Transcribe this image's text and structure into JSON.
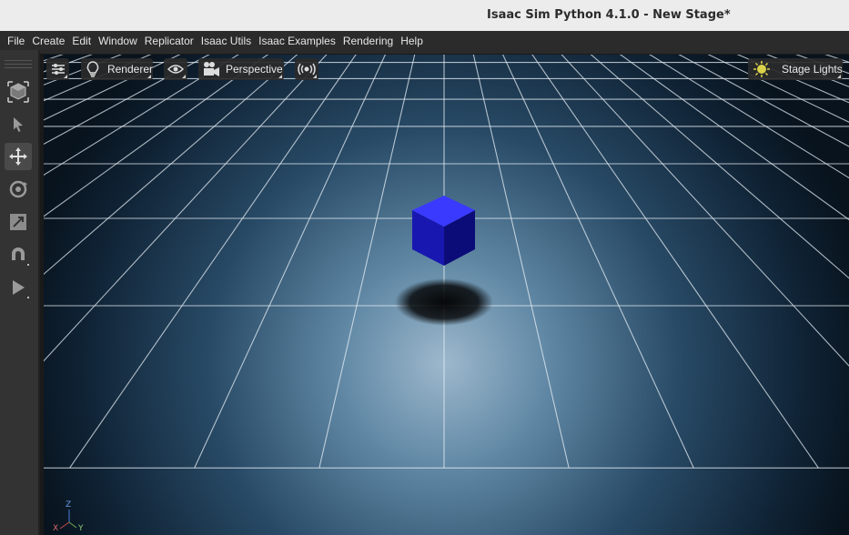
{
  "window": {
    "title": "Isaac Sim Python 4.1.0 - New Stage*"
  },
  "menubar": {
    "items": [
      "File",
      "Create",
      "Edit",
      "Window",
      "Replicator",
      "Isaac Utils",
      "Isaac Examples",
      "Rendering",
      "Help"
    ]
  },
  "left_toolbar": {
    "tools": [
      {
        "name": "select-mode-icon"
      },
      {
        "name": "select-arrow-icon"
      },
      {
        "name": "move-icon",
        "active": true
      },
      {
        "name": "rotate-icon"
      },
      {
        "name": "scale-icon"
      },
      {
        "name": "snap-magnet-icon"
      },
      {
        "name": "play-icon"
      }
    ]
  },
  "viewport_toolbar": {
    "settings_icon": "settings-sliders-icon",
    "renderer_label": "Renderer",
    "visibility_icon": "eye-icon",
    "camera_label": "Perspective",
    "audio_icon": "audio-broadcast-icon",
    "lights_label": "Stage Lights"
  },
  "axis_gizmo": {
    "x": "X",
    "y": "Y",
    "z": "Z"
  },
  "colors": {
    "cube_top": "#3a3aff",
    "cube_front": "#1818b0",
    "cube_side": "#0c0c78",
    "grid_line": "#e6eef4",
    "floor_center": "#9db8cc",
    "floor_edge": "#0a1622",
    "lights_icon": "#d9d24a"
  }
}
